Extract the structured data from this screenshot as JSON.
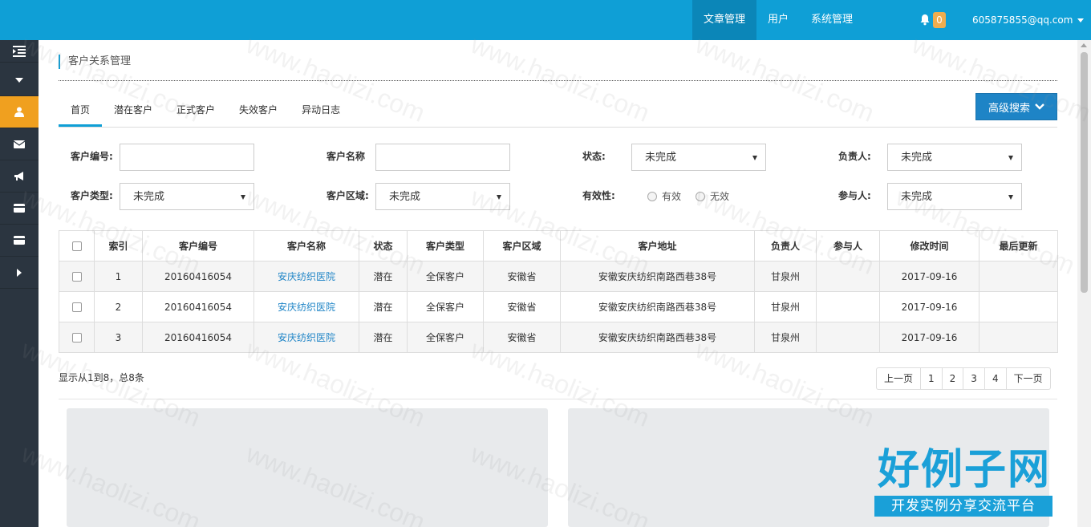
{
  "topnav": {
    "items": [
      "文章管理",
      "用户",
      "系统管理"
    ],
    "notification_count": "0",
    "user_email": "605875855@qq.com"
  },
  "sidebar": {
    "icons": [
      "indent-icon",
      "chevron-down-icon",
      "user-icon",
      "envelope-icon",
      "bullhorn-icon",
      "credit-card-icon",
      "credit-card-icon",
      "chevron-right-icon"
    ]
  },
  "page": {
    "title": "客户关系管理"
  },
  "tabs": [
    "首页",
    "潜在客户",
    "正式客户",
    "失效客户",
    "异动日志"
  ],
  "advanced_search_label": "高级搜索",
  "filters": {
    "customer_no_label": "客户编号:",
    "customer_name_label": "客户名称",
    "status_label": "状态:",
    "status_value": "未完成",
    "owner_label": "负责人:",
    "owner_value": "未完成",
    "customer_type_label": "客户类型:",
    "customer_type_value": "未完成",
    "region_label": "客户区域:",
    "region_value": "未完成",
    "validity_label": "有效性:",
    "valid_option": "有效",
    "invalid_option": "无效",
    "participant_label": "参与人:",
    "participant_value": "未完成"
  },
  "table": {
    "headers": [
      "索引",
      "客户编号",
      "客户名称",
      "状态",
      "客户类型",
      "客户区域",
      "客户地址",
      "负责人",
      "参与人",
      "修改时间",
      "最后更新"
    ],
    "rows": [
      {
        "index": "1",
        "no": "20160416054",
        "name": "安庆纺织医院",
        "status": "潜在",
        "type": "全保客户",
        "region": "安徽省",
        "address": "安徽安庆纺织南路西巷38号",
        "owner": "甘泉州",
        "participant": "",
        "modified": "2017-09-16",
        "last": ""
      },
      {
        "index": "2",
        "no": "20160416054",
        "name": "安庆纺织医院",
        "status": "潜在",
        "type": "全保客户",
        "region": "安徽省",
        "address": "安徽安庆纺织南路西巷38号",
        "owner": "甘泉州",
        "participant": "",
        "modified": "2017-09-16",
        "last": ""
      },
      {
        "index": "3",
        "no": "20160416054",
        "name": "安庆纺织医院",
        "status": "潜在",
        "type": "全保客户",
        "region": "安徽省",
        "address": "安徽安庆纺织南路西巷38号",
        "owner": "甘泉州",
        "participant": "",
        "modified": "2017-09-16",
        "last": ""
      }
    ]
  },
  "summary": "显示从1到8，总8条",
  "pagination": [
    "上一页",
    "1",
    "2",
    "3",
    "4",
    "下一页"
  ],
  "watermark": {
    "text": "www.haolizi.com",
    "logo_title": "好例子网",
    "logo_subtitle": "开发实例分享交流平台"
  },
  "colors": {
    "topbar": "#0f9fd6",
    "sidebar": "#2b3540",
    "sidebar_active": "#f0a01f",
    "primary_button": "#1e84c6",
    "link": "#1e84c6"
  }
}
